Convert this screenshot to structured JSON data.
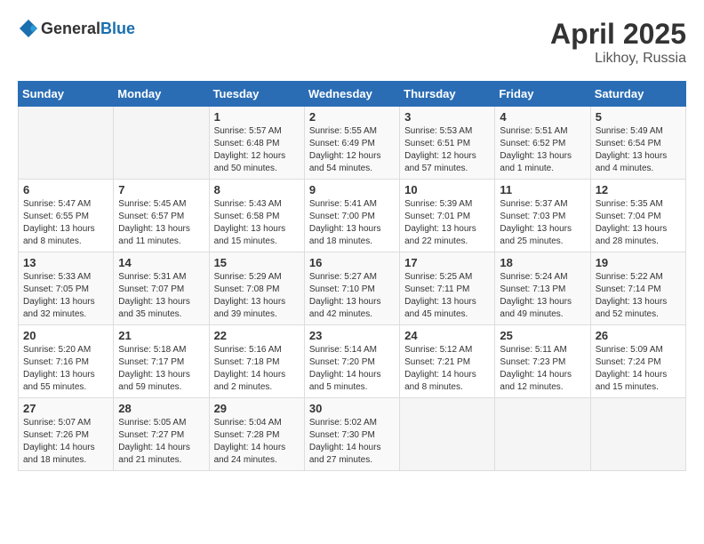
{
  "header": {
    "logo_general": "General",
    "logo_blue": "Blue",
    "month_year": "April 2025",
    "location": "Likhoy, Russia"
  },
  "weekdays": [
    "Sunday",
    "Monday",
    "Tuesday",
    "Wednesday",
    "Thursday",
    "Friday",
    "Saturday"
  ],
  "weeks": [
    [
      {
        "day": "",
        "info": ""
      },
      {
        "day": "",
        "info": ""
      },
      {
        "day": "1",
        "info": "Sunrise: 5:57 AM\nSunset: 6:48 PM\nDaylight: 12 hours\nand 50 minutes."
      },
      {
        "day": "2",
        "info": "Sunrise: 5:55 AM\nSunset: 6:49 PM\nDaylight: 12 hours\nand 54 minutes."
      },
      {
        "day": "3",
        "info": "Sunrise: 5:53 AM\nSunset: 6:51 PM\nDaylight: 12 hours\nand 57 minutes."
      },
      {
        "day": "4",
        "info": "Sunrise: 5:51 AM\nSunset: 6:52 PM\nDaylight: 13 hours\nand 1 minute."
      },
      {
        "day": "5",
        "info": "Sunrise: 5:49 AM\nSunset: 6:54 PM\nDaylight: 13 hours\nand 4 minutes."
      }
    ],
    [
      {
        "day": "6",
        "info": "Sunrise: 5:47 AM\nSunset: 6:55 PM\nDaylight: 13 hours\nand 8 minutes."
      },
      {
        "day": "7",
        "info": "Sunrise: 5:45 AM\nSunset: 6:57 PM\nDaylight: 13 hours\nand 11 minutes."
      },
      {
        "day": "8",
        "info": "Sunrise: 5:43 AM\nSunset: 6:58 PM\nDaylight: 13 hours\nand 15 minutes."
      },
      {
        "day": "9",
        "info": "Sunrise: 5:41 AM\nSunset: 7:00 PM\nDaylight: 13 hours\nand 18 minutes."
      },
      {
        "day": "10",
        "info": "Sunrise: 5:39 AM\nSunset: 7:01 PM\nDaylight: 13 hours\nand 22 minutes."
      },
      {
        "day": "11",
        "info": "Sunrise: 5:37 AM\nSunset: 7:03 PM\nDaylight: 13 hours\nand 25 minutes."
      },
      {
        "day": "12",
        "info": "Sunrise: 5:35 AM\nSunset: 7:04 PM\nDaylight: 13 hours\nand 28 minutes."
      }
    ],
    [
      {
        "day": "13",
        "info": "Sunrise: 5:33 AM\nSunset: 7:05 PM\nDaylight: 13 hours\nand 32 minutes."
      },
      {
        "day": "14",
        "info": "Sunrise: 5:31 AM\nSunset: 7:07 PM\nDaylight: 13 hours\nand 35 minutes."
      },
      {
        "day": "15",
        "info": "Sunrise: 5:29 AM\nSunset: 7:08 PM\nDaylight: 13 hours\nand 39 minutes."
      },
      {
        "day": "16",
        "info": "Sunrise: 5:27 AM\nSunset: 7:10 PM\nDaylight: 13 hours\nand 42 minutes."
      },
      {
        "day": "17",
        "info": "Sunrise: 5:25 AM\nSunset: 7:11 PM\nDaylight: 13 hours\nand 45 minutes."
      },
      {
        "day": "18",
        "info": "Sunrise: 5:24 AM\nSunset: 7:13 PM\nDaylight: 13 hours\nand 49 minutes."
      },
      {
        "day": "19",
        "info": "Sunrise: 5:22 AM\nSunset: 7:14 PM\nDaylight: 13 hours\nand 52 minutes."
      }
    ],
    [
      {
        "day": "20",
        "info": "Sunrise: 5:20 AM\nSunset: 7:16 PM\nDaylight: 13 hours\nand 55 minutes."
      },
      {
        "day": "21",
        "info": "Sunrise: 5:18 AM\nSunset: 7:17 PM\nDaylight: 13 hours\nand 59 minutes."
      },
      {
        "day": "22",
        "info": "Sunrise: 5:16 AM\nSunset: 7:18 PM\nDaylight: 14 hours\nand 2 minutes."
      },
      {
        "day": "23",
        "info": "Sunrise: 5:14 AM\nSunset: 7:20 PM\nDaylight: 14 hours\nand 5 minutes."
      },
      {
        "day": "24",
        "info": "Sunrise: 5:12 AM\nSunset: 7:21 PM\nDaylight: 14 hours\nand 8 minutes."
      },
      {
        "day": "25",
        "info": "Sunrise: 5:11 AM\nSunset: 7:23 PM\nDaylight: 14 hours\nand 12 minutes."
      },
      {
        "day": "26",
        "info": "Sunrise: 5:09 AM\nSunset: 7:24 PM\nDaylight: 14 hours\nand 15 minutes."
      }
    ],
    [
      {
        "day": "27",
        "info": "Sunrise: 5:07 AM\nSunset: 7:26 PM\nDaylight: 14 hours\nand 18 minutes."
      },
      {
        "day": "28",
        "info": "Sunrise: 5:05 AM\nSunset: 7:27 PM\nDaylight: 14 hours\nand 21 minutes."
      },
      {
        "day": "29",
        "info": "Sunrise: 5:04 AM\nSunset: 7:28 PM\nDaylight: 14 hours\nand 24 minutes."
      },
      {
        "day": "30",
        "info": "Sunrise: 5:02 AM\nSunset: 7:30 PM\nDaylight: 14 hours\nand 27 minutes."
      },
      {
        "day": "",
        "info": ""
      },
      {
        "day": "",
        "info": ""
      },
      {
        "day": "",
        "info": ""
      }
    ]
  ]
}
